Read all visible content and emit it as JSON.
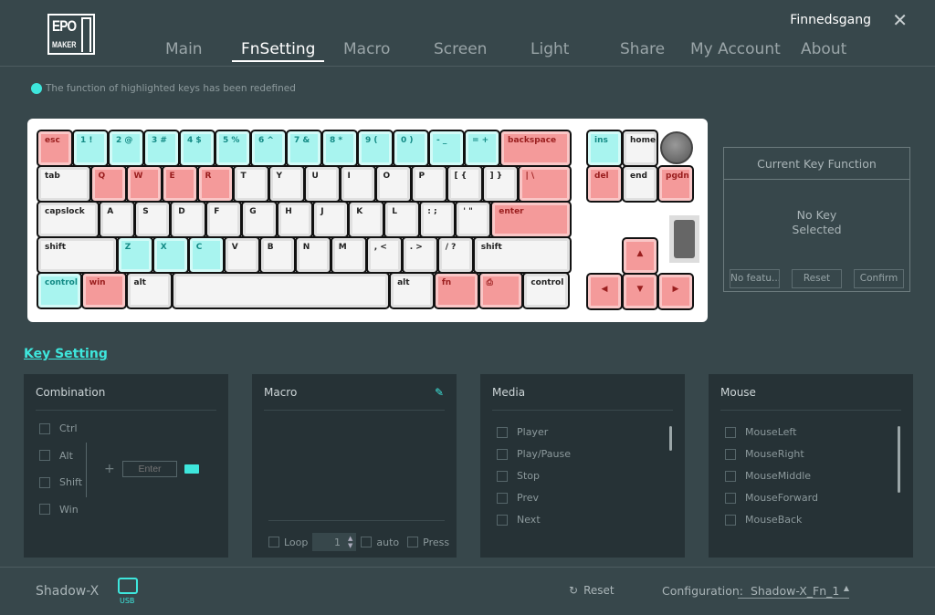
{
  "logo": {
    "line1": "EPOM",
    "line2": "MAKER"
  },
  "nav": [
    {
      "label": "Main"
    },
    {
      "label": "FnSetting",
      "active": true
    },
    {
      "label": "Macro"
    },
    {
      "label": "Screen"
    },
    {
      "label": "Light"
    },
    {
      "label": "Share"
    },
    {
      "label": "My Account"
    },
    {
      "label": "About"
    }
  ],
  "user": "Finnedsgang",
  "close_icon": "close-icon",
  "hint": "The function of highlighted keys has been redefined",
  "colors": {
    "accent": "#3ee6dc",
    "redefined_red": "#f49a9a",
    "redefined_cyan": "#a8f4ef",
    "background": "#37474b",
    "panel": "#263236"
  },
  "keyboard": {
    "rows": [
      [
        [
          "esc",
          "r"
        ],
        [
          "1 !",
          "c"
        ],
        [
          "2 @",
          "c"
        ],
        [
          "3 #",
          "c"
        ],
        [
          "4 $",
          "c"
        ],
        [
          "5 %",
          "c"
        ],
        [
          "6 ^",
          "c"
        ],
        [
          "7 &",
          "c"
        ],
        [
          "8 *",
          "c"
        ],
        [
          "9 (",
          "c"
        ],
        [
          "0 )",
          "c"
        ],
        [
          "- _",
          "c"
        ],
        [
          "= +",
          "c"
        ],
        [
          "backspace",
          "r"
        ]
      ],
      [
        [
          "tab",
          "w"
        ],
        [
          "Q",
          "r"
        ],
        [
          "W",
          "r"
        ],
        [
          "E",
          "r"
        ],
        [
          "R",
          "r"
        ],
        [
          "T",
          "w"
        ],
        [
          "Y",
          "w"
        ],
        [
          "U",
          "w"
        ],
        [
          "I",
          "w"
        ],
        [
          "O",
          "w"
        ],
        [
          "P",
          "w"
        ],
        [
          "[ {",
          "w"
        ],
        [
          "] }",
          "w"
        ],
        [
          "| \\",
          "r"
        ]
      ],
      [
        [
          "capslock",
          "w"
        ],
        [
          "A",
          "w"
        ],
        [
          "S",
          "w"
        ],
        [
          "D",
          "w"
        ],
        [
          "F",
          "w"
        ],
        [
          "G",
          "w"
        ],
        [
          "H",
          "w"
        ],
        [
          "J",
          "w"
        ],
        [
          "K",
          "w"
        ],
        [
          "L",
          "w"
        ],
        [
          ": ;",
          "w"
        ],
        [
          "' \"",
          "w"
        ],
        [
          "enter",
          "r"
        ]
      ],
      [
        [
          "shift",
          "w"
        ],
        [
          "Z",
          "c"
        ],
        [
          "X",
          "c"
        ],
        [
          "C",
          "c"
        ],
        [
          "V",
          "w"
        ],
        [
          "B",
          "w"
        ],
        [
          "N",
          "w"
        ],
        [
          "M",
          "w"
        ],
        [
          ", <",
          "w"
        ],
        [
          ". >",
          "w"
        ],
        [
          "/ ?",
          "w"
        ],
        [
          "shift",
          "w"
        ]
      ],
      [
        [
          "control",
          "c"
        ],
        [
          "win",
          "r"
        ],
        [
          "alt",
          "w"
        ],
        [
          "",
          "w"
        ],
        [
          "alt",
          "w"
        ],
        [
          "fn",
          "r"
        ],
        [
          "⎙",
          "r"
        ],
        [
          "control",
          "w"
        ]
      ]
    ],
    "nav_cluster": [
      [
        "ins",
        "c"
      ],
      [
        "home",
        "w"
      ],
      [
        "del",
        "r"
      ],
      [
        "end",
        "w"
      ],
      [
        "pgdn",
        "r"
      ],
      [
        "▲",
        "r"
      ],
      [
        "◀",
        "r"
      ],
      [
        "▼",
        "r"
      ],
      [
        "▶",
        "r"
      ]
    ]
  },
  "current_key": {
    "title": "Current Key Function",
    "status_line1": "No Key",
    "status_line2": "Selected",
    "buttons": [
      "No featu...",
      "Reset",
      "Confirm"
    ]
  },
  "key_setting": "Key Setting",
  "combination": {
    "title": "Combination",
    "modifiers": [
      "Ctrl",
      "Alt",
      "Shift",
      "Win"
    ],
    "plus": "+",
    "input_placeholder": "Enter"
  },
  "macro": {
    "title": "Macro",
    "loop": "Loop",
    "count": "1",
    "auto": "auto",
    "press": "Press"
  },
  "media": {
    "title": "Media",
    "items": [
      "Player",
      "Play/Pause",
      "Stop",
      "Prev",
      "Next"
    ]
  },
  "mouse": {
    "title": "Mouse",
    "items": [
      "MouseLeft",
      "MouseRight",
      "MouseMiddle",
      "MouseForward",
      "MouseBack"
    ]
  },
  "footer": {
    "device": "Shadow-X",
    "connection": "USB",
    "reset": "Reset",
    "config_label": "Configuration:",
    "config_value": "Shadow-X_Fn_1"
  }
}
